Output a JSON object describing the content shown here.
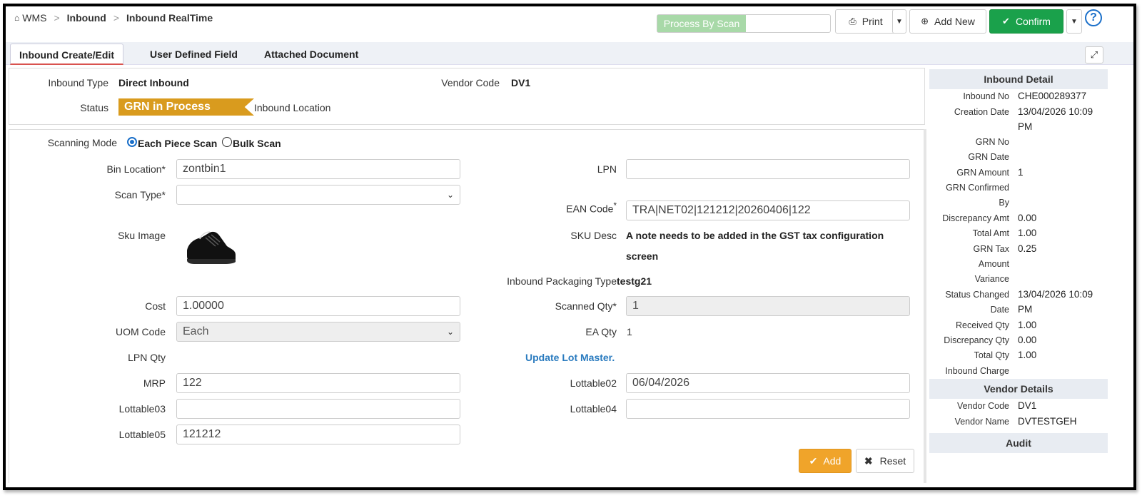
{
  "breadcrumb": {
    "root": "WMS",
    "section": "Inbound",
    "page": "Inbound RealTime"
  },
  "toolbar": {
    "process_by_scan": "Process By Scan",
    "print": "Print",
    "add_new": "Add New",
    "confirm": "Confirm"
  },
  "tabs": [
    {
      "label": "Inbound Create/Edit"
    },
    {
      "label": "User Defined Field"
    },
    {
      "label": "Attached Document"
    }
  ],
  "header": {
    "inbound_type_label": "Inbound Type",
    "inbound_type_value": "Direct Inbound",
    "vendor_code_label": "Vendor Code",
    "vendor_code_value": "DV1",
    "status_label": "Status",
    "status_value": "GRN in Process",
    "inbound_location_label": "Inbound Location"
  },
  "form": {
    "scanning_mode_label": "Scanning Mode",
    "each_piece_scan": "Each Piece Scan",
    "bulk_scan": "Bulk Scan",
    "bin_location_label": "Bin Location*",
    "bin_location_value": "zontbin1",
    "lpn_label": "LPN",
    "lpn_value": "",
    "scan_type_label": "Scan Type*",
    "scan_type_value": "",
    "ean_code_label": "EAN Code",
    "ean_code_value": "TRA|NET02|121212|20260406|122",
    "sku_image_label": "Sku Image",
    "sku_desc_label": "SKU Desc",
    "sku_desc_line1": "A note needs to be added in the GST tax configuration",
    "sku_desc_line2": "screen",
    "packaging_type_label": "Inbound Packaging Type",
    "packaging_type_value": "testg21",
    "cost_label": "Cost",
    "cost_value": "1.00000",
    "scanned_qty_label": "Scanned Qty*",
    "scanned_qty_value": "1",
    "uom_code_label": "UOM Code",
    "uom_code_value": "Each",
    "ea_qty_label": "EA Qty",
    "ea_qty_value": "1",
    "lpn_qty_label": "LPN Qty",
    "update_lot_master": "Update Lot Master.",
    "mrp_label": "MRP",
    "mrp_value": "122",
    "lottable02_label": "Lottable02",
    "lottable02_value": "06/04/2026",
    "lottable03_label": "Lottable03",
    "lottable03_value": "",
    "lottable04_label": "Lottable04",
    "lottable04_value": "",
    "lottable05_label": "Lottable05",
    "lottable05_value": "121212",
    "add_button": "Add",
    "reset_button": "Reset"
  },
  "inbound_detail": {
    "title": "Inbound Detail",
    "inbound_no_label": "Inbound No",
    "inbound_no_value": "CHE000289377",
    "creation_date_label": "Creation Date",
    "creation_date_value1": "13/04/2026 10:09",
    "creation_date_value2": "PM",
    "grn_no_label": "GRN No",
    "grn_date_label": "GRN Date",
    "grn_amount_label": "GRN Amount",
    "grn_amount_value": "1",
    "grn_confirmed_label1": "GRN Confirmed",
    "grn_confirmed_label2": "By",
    "discrepancy_amt_label": "Discrepancy Amt",
    "discrepancy_amt_value": "0.00",
    "total_amt_label": "Total Amt",
    "total_amt_value": "1.00",
    "grn_tax_label1": "GRN Tax",
    "grn_tax_label2": "Amount",
    "grn_tax_value": "0.25",
    "variance_label": "Variance",
    "status_changed_label1": "Status Changed",
    "status_changed_label2": "Date",
    "status_changed_value1": "13/04/2026 10:09",
    "status_changed_value2": "PM",
    "received_qty_label": "Received Qty",
    "received_qty_value": "1.00",
    "discrepancy_qty_label": "Discrepancy Qty",
    "discrepancy_qty_value": "0.00",
    "total_qty_label": "Total Qty",
    "total_qty_value": "1.00",
    "inbound_charge_label": "Inbound Charge"
  },
  "vendor_details": {
    "title": "Vendor Details",
    "vendor_code_label": "Vendor Code",
    "vendor_code_value": "DV1",
    "vendor_name_label": "Vendor Name",
    "vendor_name_value": "DVTESTGEH"
  },
  "audit": {
    "title": "Audit"
  }
}
